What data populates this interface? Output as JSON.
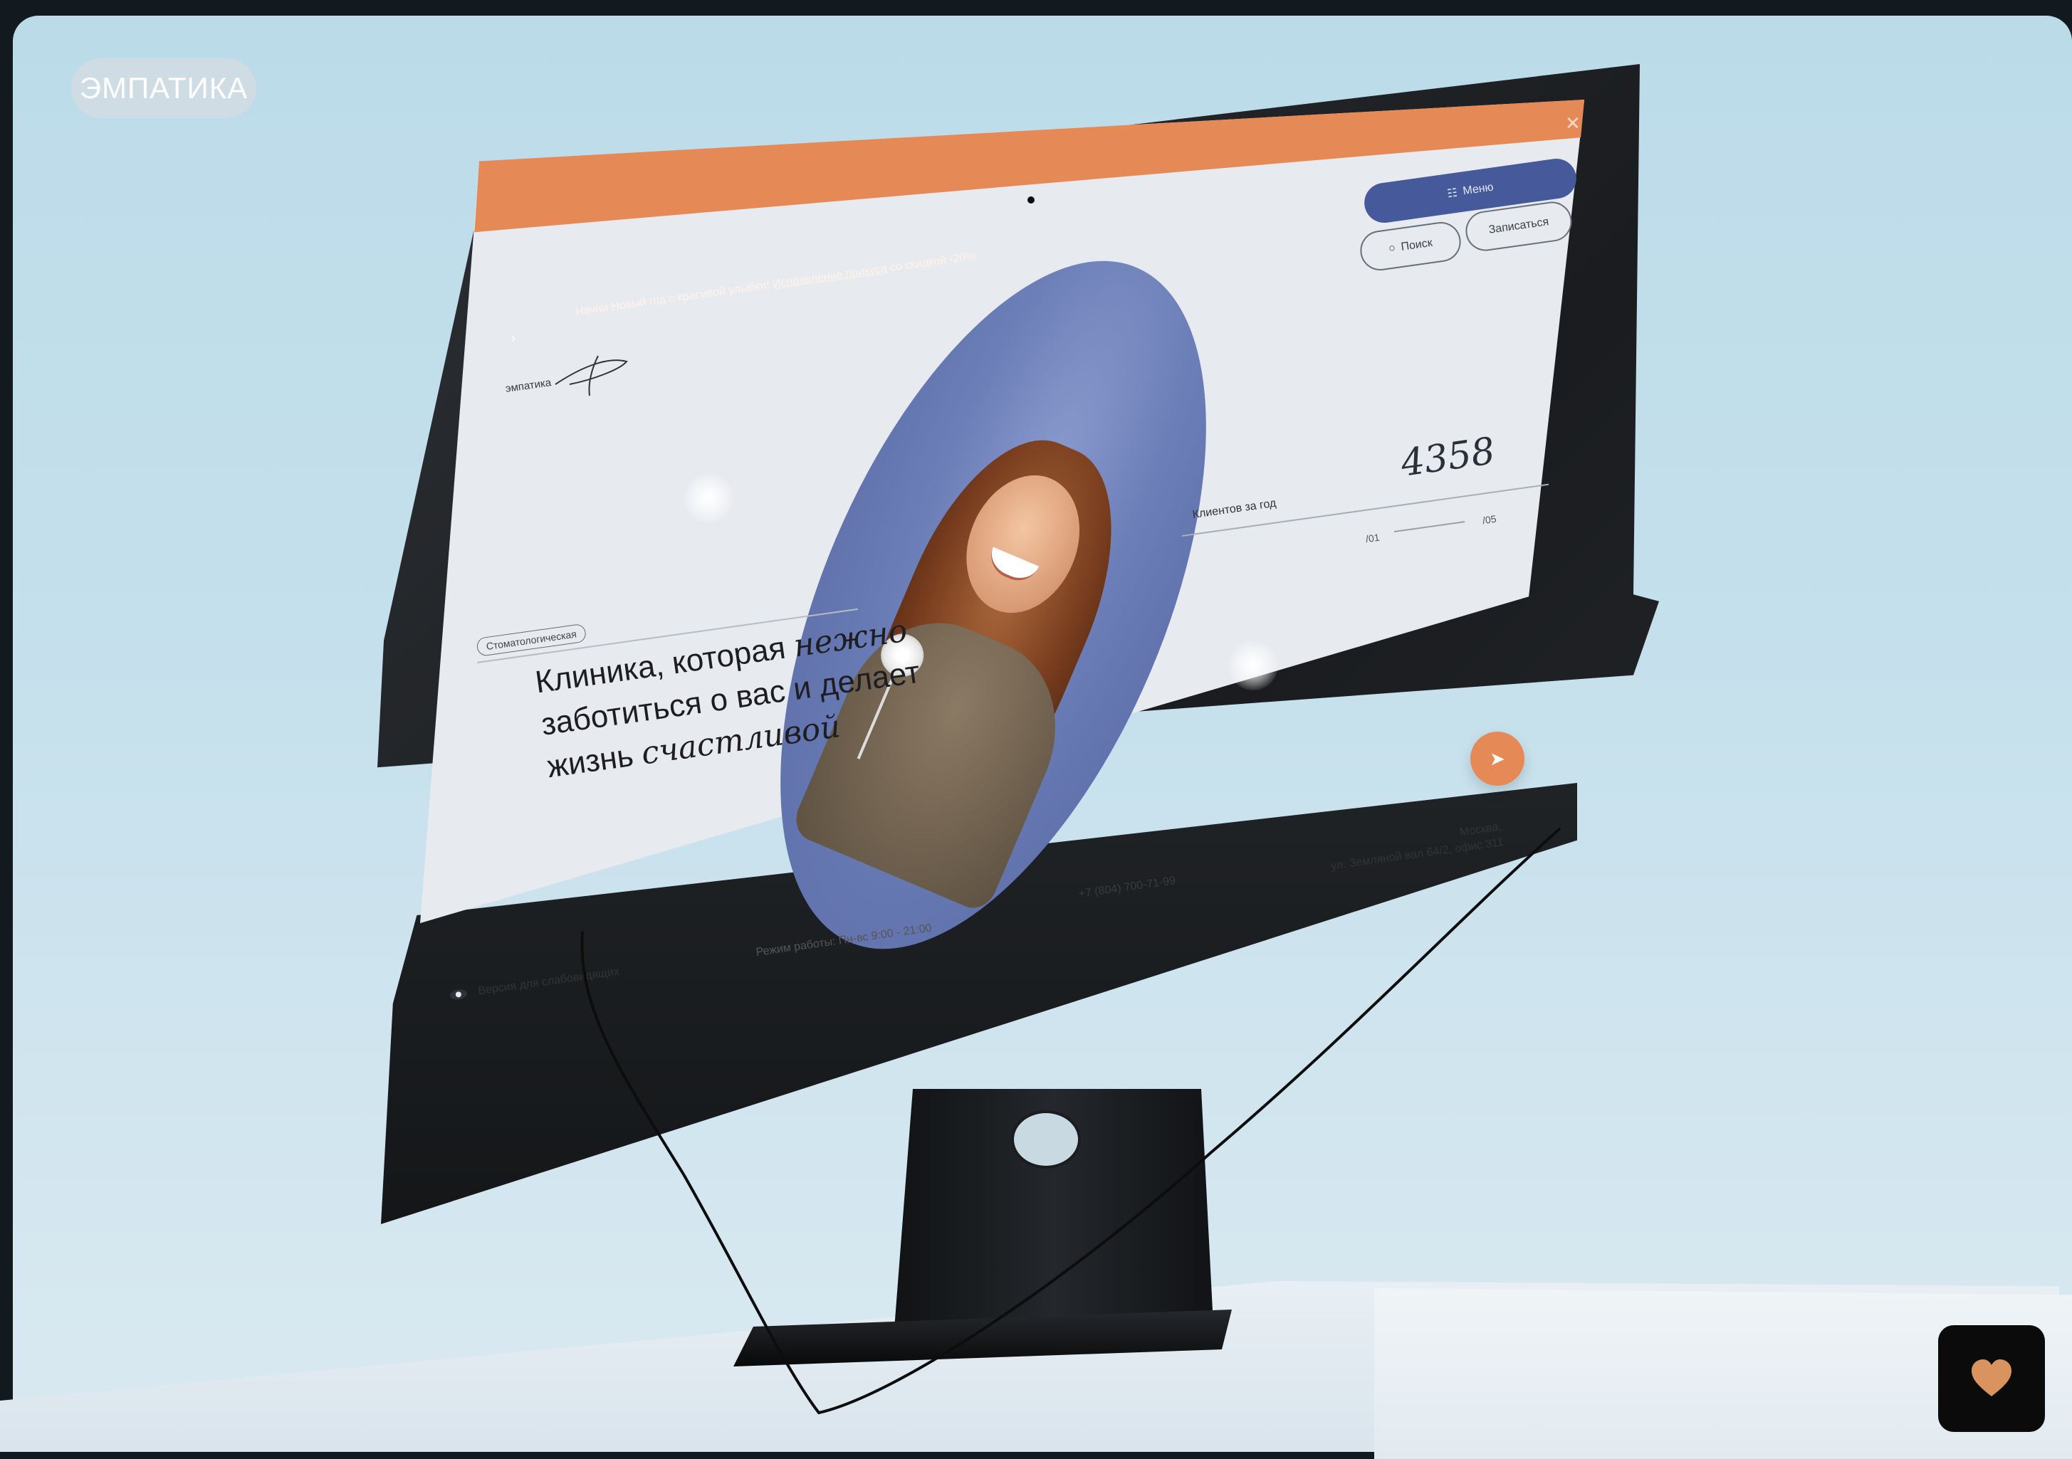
{
  "badge": {
    "label": "ЭМПАТИКА"
  },
  "site": {
    "promo": {
      "text": "Начни Новый год с красивой улыбки!",
      "link": "Исправление прикуса",
      "suffix": "со скидкой -20%"
    },
    "logo_text": "эмпатика",
    "tag": "Стоматологическая",
    "headline": {
      "part1": "Клиника, которая",
      "italic1": "нежно",
      "part2": "заботиться о вас и делает",
      "part3": "жизнь",
      "italic2": "счастливой"
    },
    "counter": {
      "label": "Клиентов за год",
      "value": "4358"
    },
    "slider": {
      "from": "/01",
      "to": "/05"
    },
    "buttons": {
      "menu": "Меню",
      "search": "Поиск",
      "book": "Записаться"
    },
    "phone": "+7 (804) 700-71-99",
    "hours": "Режим работы: Пн-вс 9:00 - 21:00",
    "address": {
      "line1": "Москва,",
      "line2": "ул. Земляной вал 64/2, офис 311"
    },
    "accessibility": "Версия для слабовидящих"
  },
  "icons": {
    "search": "search-icon",
    "menu": "menu-icon",
    "send": "send-icon",
    "eye": "eye-icon",
    "heart": "heart-icon",
    "close": "close-icon"
  },
  "colors": {
    "accent_orange": "#e58a56",
    "menu_blue": "#46599a",
    "oval_blue": "#6c7fb7",
    "background_sky": "#c3deeb",
    "dark": "#0b0b0c"
  }
}
